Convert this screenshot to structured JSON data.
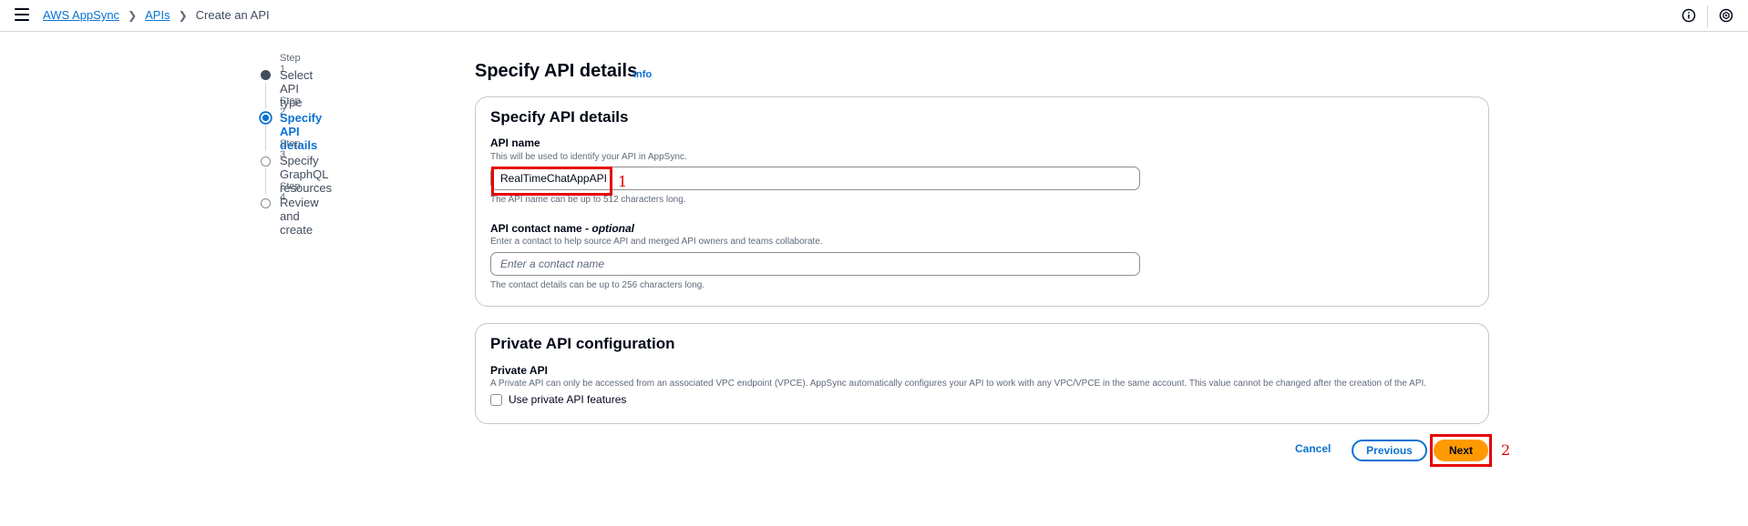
{
  "header": {
    "breadcrumbs": [
      "AWS AppSync",
      "APIs",
      "Create an API"
    ],
    "icons": [
      "menu-icon",
      "info-circle-icon",
      "settings-circle-icon"
    ]
  },
  "steps": [
    {
      "number": "Step 1",
      "title": "Select API type",
      "state": "completed"
    },
    {
      "number": "Step 2",
      "title": "Specify API details",
      "state": "active"
    },
    {
      "number": "Step 3",
      "title": "Specify GraphQL resources",
      "state": "pending"
    },
    {
      "number": "Step 4",
      "title": "Review and create",
      "state": "pending"
    }
  ],
  "main": {
    "title": "Specify API details",
    "info_label": "Info",
    "details_card": {
      "title": "Specify API details",
      "api_name": {
        "label": "API name",
        "description": "This will be used to identify your API in AppSync.",
        "value": "RealTimeChatAppAPI",
        "constraint": "The API name can be up to 512 characters long."
      },
      "contact_name": {
        "label": "API contact name - ",
        "label_optional": "optional",
        "description": "Enter a contact to help source API and merged API owners and teams collaborate.",
        "placeholder": "Enter a contact name",
        "constraint": "The contact details can be up to 256 characters long."
      }
    },
    "private_card": {
      "title": "Private API configuration",
      "label": "Private API",
      "description": "A Private API can only be accessed from an associated VPC endpoint (VPCE). AppSync automatically configures your API to work with any VPC/VPCE in the same account. This value cannot be changed after the creation of the API.",
      "checkbox_label": "Use private API features",
      "checked": false
    },
    "actions": {
      "cancel": "Cancel",
      "previous": "Previous",
      "next": "Next"
    }
  },
  "annotations": [
    {
      "label": "1"
    },
    {
      "label": "2"
    }
  ],
  "colors": {
    "link": "#0972d3",
    "primary_button": "#ff9900",
    "annotation": "#e60000"
  }
}
